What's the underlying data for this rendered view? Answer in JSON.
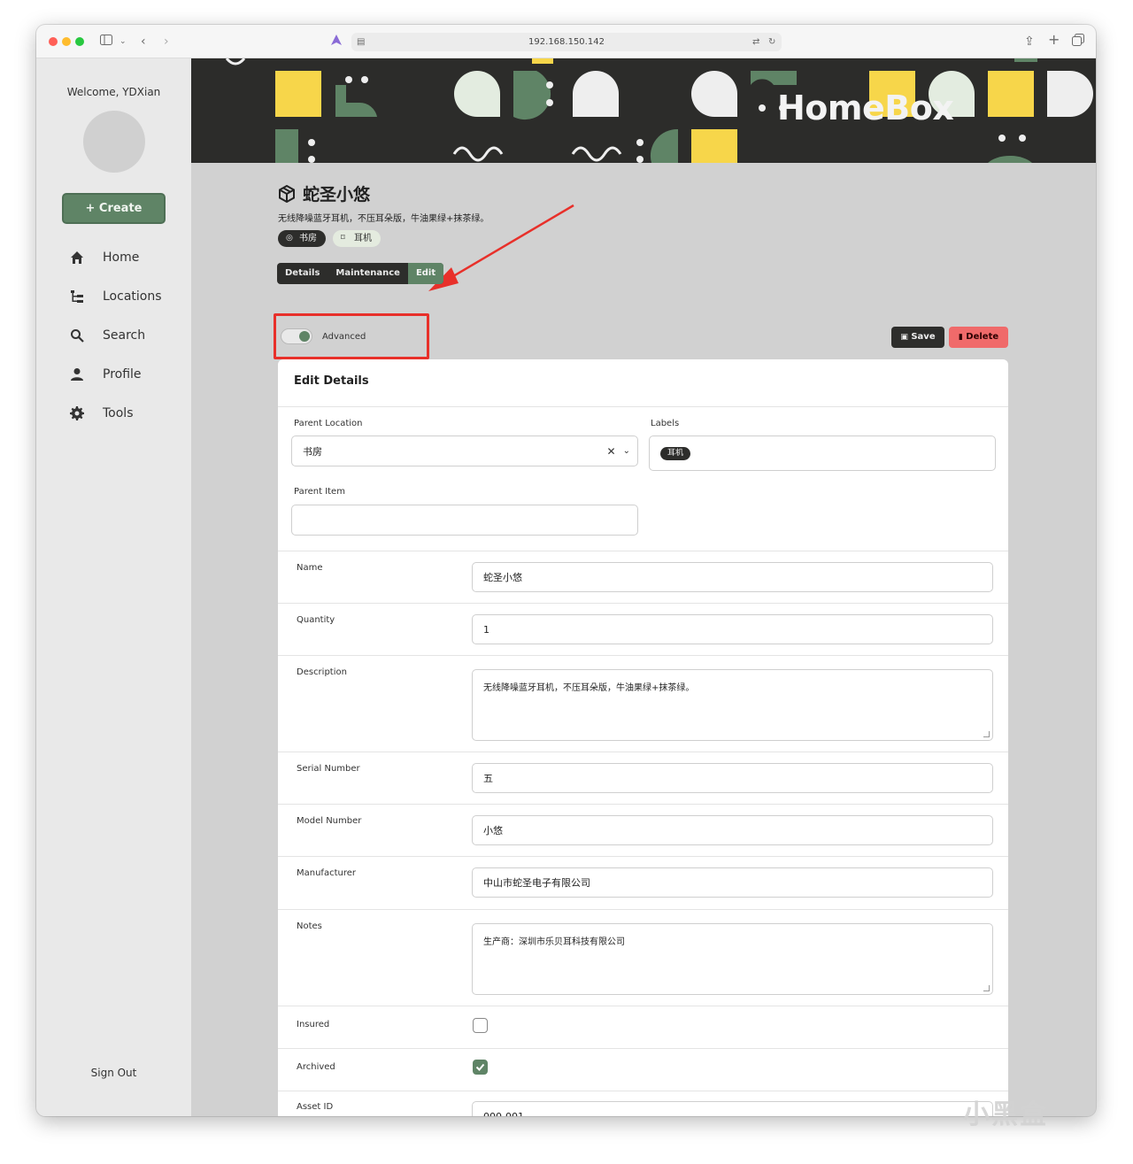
{
  "browser": {
    "url": "192.168.150.142"
  },
  "sidebar": {
    "welcome": "Welcome, YDXian",
    "create_label": "+ Create",
    "items": [
      {
        "label": "Home",
        "icon": "home-icon"
      },
      {
        "label": "Locations",
        "icon": "tree-icon"
      },
      {
        "label": "Search",
        "icon": "search-icon"
      },
      {
        "label": "Profile",
        "icon": "person-icon"
      },
      {
        "label": "Tools",
        "icon": "gear-icon"
      }
    ],
    "sign_out": "Sign Out"
  },
  "banner": {
    "brand": "HomeBox"
  },
  "item": {
    "title": "蛇圣小悠",
    "description": "无线降噪蓝牙耳机，不压耳朵版，牛油果绿+抹茶绿。",
    "location_chip": "书房",
    "label_chip": "耳机"
  },
  "tabs": [
    {
      "label": "Details",
      "active": false
    },
    {
      "label": "Maintenance",
      "active": false
    },
    {
      "label": "Edit",
      "active": true
    }
  ],
  "toolbar": {
    "advanced_label": "Advanced",
    "advanced_on": true,
    "save_label": "Save",
    "delete_label": "Delete"
  },
  "form": {
    "card_title": "Edit Details",
    "parent_location_label": "Parent Location",
    "parent_location_value": "书房",
    "labels_label": "Labels",
    "labels_value": "耳机",
    "parent_item_label": "Parent Item",
    "parent_item_value": "",
    "name_label": "Name",
    "name_value": "蛇圣小悠",
    "quantity_label": "Quantity",
    "quantity_value": "1",
    "description_label": "Description",
    "description_value": "无线降噪蓝牙耳机，不压耳朵版，牛油果绿+抹茶绿。",
    "serial_label": "Serial Number",
    "serial_value": "五",
    "model_label": "Model Number",
    "model_value": "小悠",
    "manufacturer_label": "Manufacturer",
    "manufacturer_value": "中山市蛇圣电子有限公司",
    "notes_label": "Notes",
    "notes_value": "生产商：深圳市乐贝耳科技有限公司",
    "insured_label": "Insured",
    "insured": false,
    "archived_label": "Archived",
    "archived": true,
    "asset_id_label": "Asset ID",
    "asset_id_value": "000-001"
  },
  "watermark": "小黑盒",
  "colors": {
    "accent": "#5f8466",
    "dark": "#2d2d2b",
    "danger": "#f06a6a",
    "annotation": "#e8302a",
    "banner_yellow": "#f7d64a",
    "banner_green": "#5f8466",
    "banner_mint": "#e3ece0"
  }
}
